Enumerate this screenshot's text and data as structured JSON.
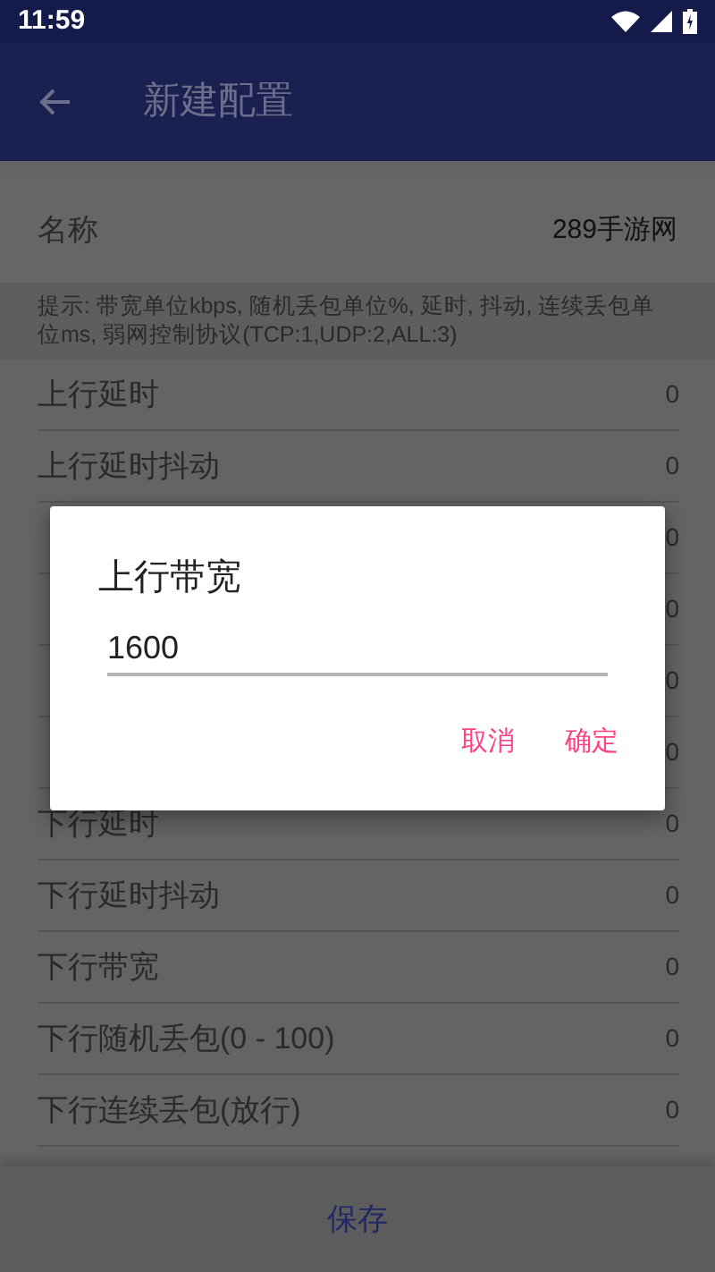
{
  "status_bar": {
    "time": "11:59"
  },
  "app_bar": {
    "title": "新建配置"
  },
  "name_row": {
    "label": "名称",
    "value": "289手游网"
  },
  "hint": "提示: 带宽单位kbps, 随机丢包单位%, 延时, 抖动, 连续丢包单位ms, 弱网控制协议(TCP:1,UDP:2,ALL:3)",
  "rows": [
    {
      "label": "上行延时",
      "value": "0"
    },
    {
      "label": "上行延时抖动",
      "value": "0"
    },
    {
      "value": "0"
    },
    {
      "value": "0"
    },
    {
      "value": "0"
    },
    {
      "value": "0"
    },
    {
      "label": "下行延时",
      "value": "0"
    },
    {
      "label": "下行延时抖动",
      "value": "0"
    },
    {
      "label": "下行带宽",
      "value": "0"
    },
    {
      "label": "下行随机丢包(0 - 100)",
      "value": "0"
    },
    {
      "label": "下行连续丢包(放行)",
      "value": "0"
    }
  ],
  "save_button": "保存",
  "dialog": {
    "title": "上行带宽",
    "value": "1600",
    "buttons": [
      "取消",
      "确定"
    ]
  }
}
